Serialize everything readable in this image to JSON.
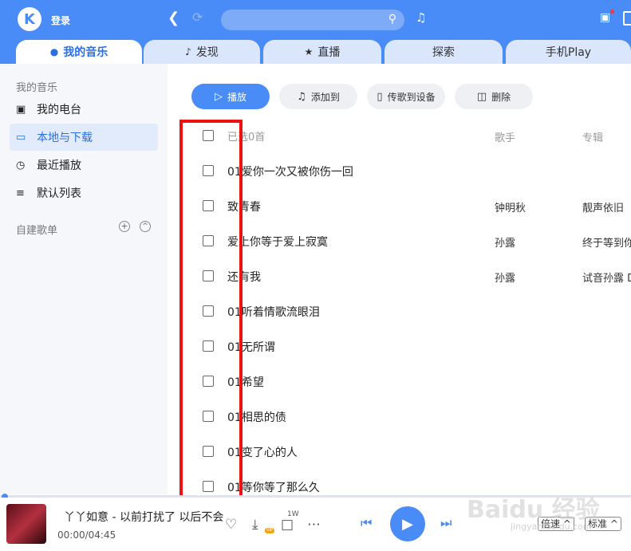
{
  "app": {
    "logo_letter": "K",
    "login": "登录"
  },
  "top_tabs": [
    {
      "label": "我的音乐",
      "icon": "user-icon"
    },
    {
      "label": "发现",
      "icon": "music-note-icon"
    },
    {
      "label": "直播",
      "icon": "live-icon"
    },
    {
      "label": "探索",
      "icon": ""
    },
    {
      "label": "手机Play",
      "icon": ""
    }
  ],
  "sidebar": {
    "title": "我的音乐",
    "items": [
      {
        "label": "我的电台",
        "icon": "radio-icon"
      },
      {
        "label": "本地与下载",
        "icon": "monitor-icon"
      },
      {
        "label": "最近播放",
        "icon": "clock-icon"
      },
      {
        "label": "默认列表",
        "icon": "playlist-icon"
      }
    ],
    "custom_title": "自建歌单"
  },
  "actions": {
    "play": "播放",
    "add_to": "添加到",
    "send_to_device": "传歌到设备",
    "delete": "删除"
  },
  "table": {
    "header": {
      "selected": "已选0首",
      "artist": "歌手",
      "album": "专辑"
    },
    "rows": [
      {
        "title": "01爱你一次又被你伤一回",
        "artist": "",
        "album": ""
      },
      {
        "title": "致青春",
        "artist": "钟明秋",
        "album": "靓声依旧"
      },
      {
        "title": "爱上你等于爱上寂寞",
        "artist": "孙露",
        "album": "终于等到你"
      },
      {
        "title": "还有我",
        "artist": "孙露",
        "album": "试音孙露 D"
      },
      {
        "title": "01听着情歌流眼泪",
        "artist": "",
        "album": ""
      },
      {
        "title": "01无所谓",
        "artist": "",
        "album": ""
      },
      {
        "title": "01希望",
        "artist": "",
        "album": ""
      },
      {
        "title": "01相思的债",
        "artist": "",
        "album": ""
      },
      {
        "title": "01变了心的人",
        "artist": "",
        "album": ""
      },
      {
        "title": "01等你等了那么久",
        "artist": "",
        "album": ""
      }
    ]
  },
  "player": {
    "song": "丫丫如意 - 以前打扰了 以后不会",
    "time": "00:00/04:45",
    "comment_count": "1W",
    "vip": "VIP",
    "speed": "倍速",
    "quality": "标准"
  },
  "watermark": {
    "text": "Baidu 经验",
    "sub": "jingyan.baidu.com"
  },
  "colors": {
    "accent": "#4a8cf7",
    "highlight": "#ee1111"
  }
}
